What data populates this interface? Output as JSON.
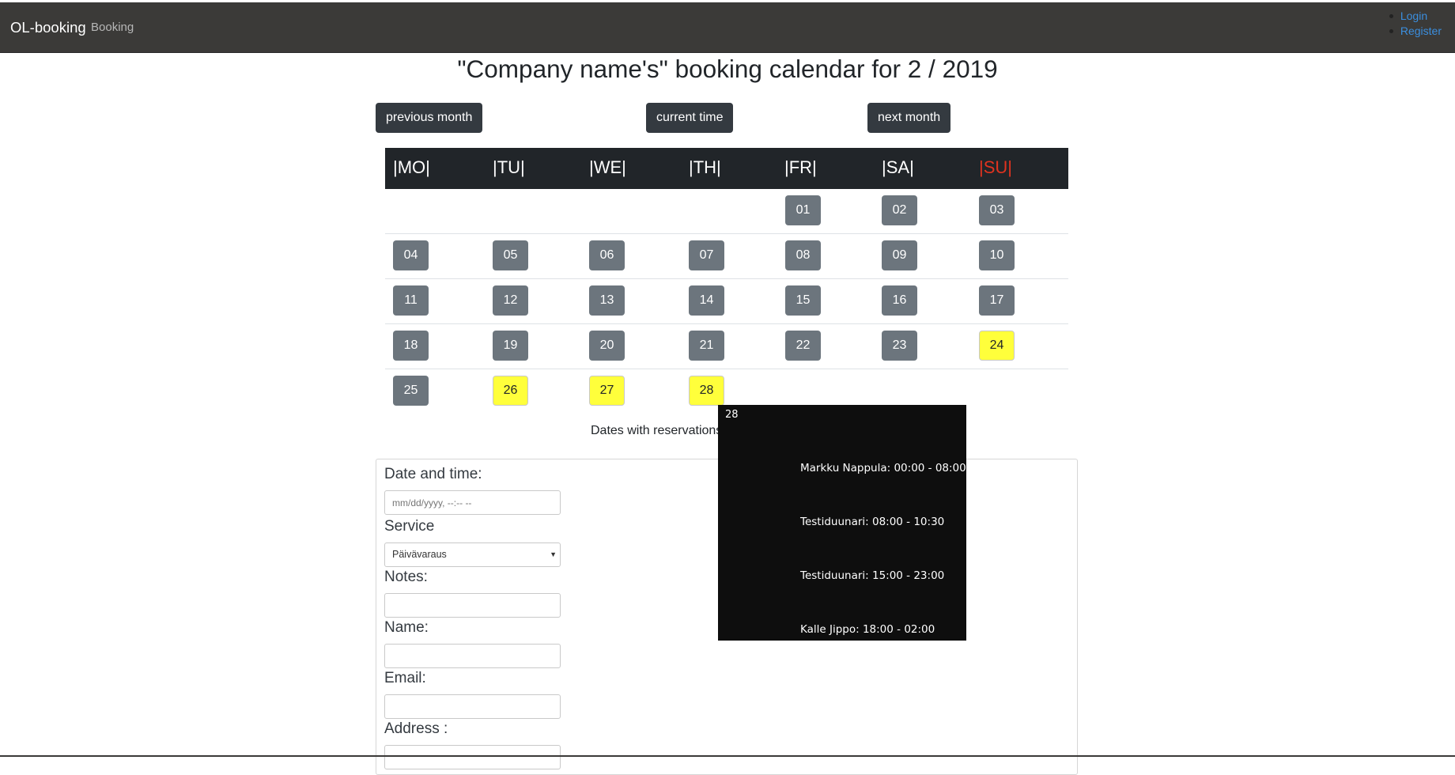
{
  "navbar": {
    "brand": "OL-booking",
    "link": "Booking",
    "auth": [
      "Login",
      "Register"
    ]
  },
  "title": "\"Company name's\" booking calendar for 2 / 2019",
  "buttons": {
    "previous": "previous month",
    "current": "current time",
    "next": "next month"
  },
  "weekdays": [
    "|MO|",
    "|TU|",
    "|WE|",
    "|TH|",
    "|FR|",
    "|SA|",
    "|SU|"
  ],
  "weeks": [
    [
      null,
      null,
      null,
      null,
      "01",
      "02",
      "03"
    ],
    [
      "04",
      "05",
      "06",
      "07",
      "08",
      "09",
      "10"
    ],
    [
      "11",
      "12",
      "13",
      "14",
      "15",
      "16",
      "17"
    ],
    [
      "18",
      "19",
      "20",
      "21",
      "22",
      "23",
      "24"
    ],
    [
      "25",
      "26",
      "27",
      "28",
      null,
      null,
      null
    ]
  ],
  "reserved_days": [
    "24",
    "26",
    "27",
    "28"
  ],
  "colors": {
    "reserved": "#ffff3b",
    "day": "#6c757d",
    "sunday": "#e0331f"
  },
  "legend": "Dates with reservations",
  "tooltip": {
    "date": "28",
    "entries": [
      "Markku Nappula: 00:00 - 08:00",
      "Testiduunari: 08:00 - 10:30",
      "Testiduunari: 15:00 - 23:00",
      "Kalle Jippo: 18:00 - 02:00"
    ]
  },
  "form": {
    "datetime_label": "Date and time:",
    "datetime_placeholder": "mm/dd/yyyy, --:-- --",
    "service_label": "Service",
    "service_value": "Päivävaraus",
    "notes_label": "Notes:",
    "name_label": "Name:",
    "email_label": "Email:",
    "address_label": "Address :"
  }
}
